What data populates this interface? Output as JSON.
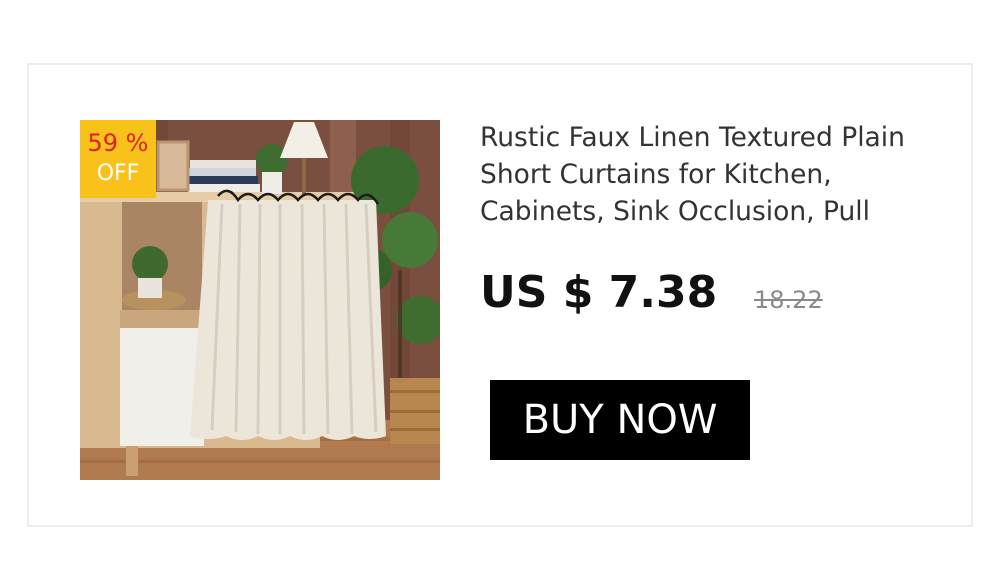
{
  "product": {
    "title": "Rustic Faux Linen Textured Plain Short Curtains for Kitchen, Cabinets, Sink Occlusion, Pull",
    "image_alt": "Linen short curtain hanging under a wooden cabinet",
    "discount": {
      "percent": "59 %",
      "label": "OFF"
    },
    "price": {
      "current": "US $ 7.38",
      "original": "18.22"
    },
    "buy_button_label": "BUY NOW"
  },
  "colors": {
    "badge_background": "#f8c21b",
    "badge_percent_text": "#e0201e",
    "button_background": "#000000",
    "button_text": "#ffffff",
    "original_price": "#8a8a8a"
  }
}
